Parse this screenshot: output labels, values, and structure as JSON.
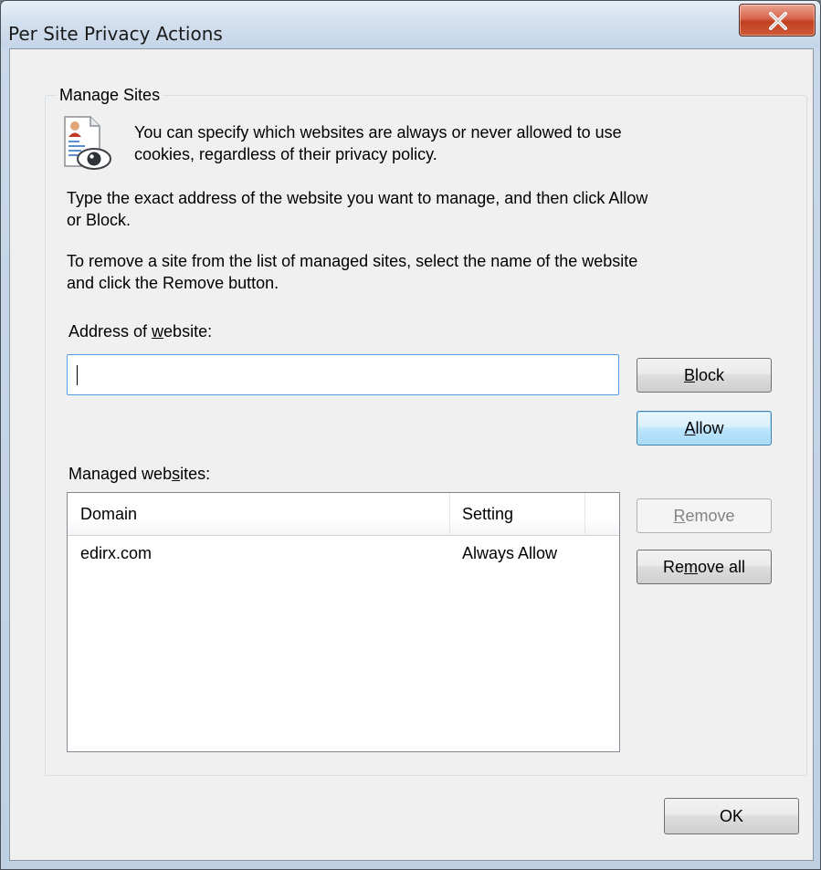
{
  "window": {
    "title": "Per Site Privacy Actions",
    "close_icon": "close-x-icon"
  },
  "group": {
    "legend": "Manage Sites",
    "icon": "privacy-cookie-icon",
    "intro_line1": "You can specify which websites are always or never allowed to use",
    "intro_line2": "cookies, regardless of their privacy policy.",
    "instr1_line1": "Type the exact address of the website you want to manage, and then click Allow",
    "instr1_line2": "or Block.",
    "instr2_line1": "To remove a site from the list of managed sites, select the name of the website",
    "instr2_line2": "and click the Remove button."
  },
  "address": {
    "label_pre": "Address of ",
    "label_key": "w",
    "label_post": "ebsite:",
    "value": ""
  },
  "buttons": {
    "block": {
      "key": "B",
      "rest": "lock"
    },
    "allow": {
      "key": "A",
      "rest": "llow"
    },
    "remove": {
      "key": "R",
      "rest": "emove",
      "enabled": false
    },
    "remove_all": {
      "pre": "Re",
      "key": "m",
      "rest": "ove all"
    },
    "ok": "OK"
  },
  "managed": {
    "label_pre": "Managed web",
    "label_key": "s",
    "label_post": "ites:",
    "columns": [
      "Domain",
      "Setting"
    ],
    "rows": [
      {
        "domain": "edirx.com",
        "setting": "Always Allow"
      }
    ]
  }
}
